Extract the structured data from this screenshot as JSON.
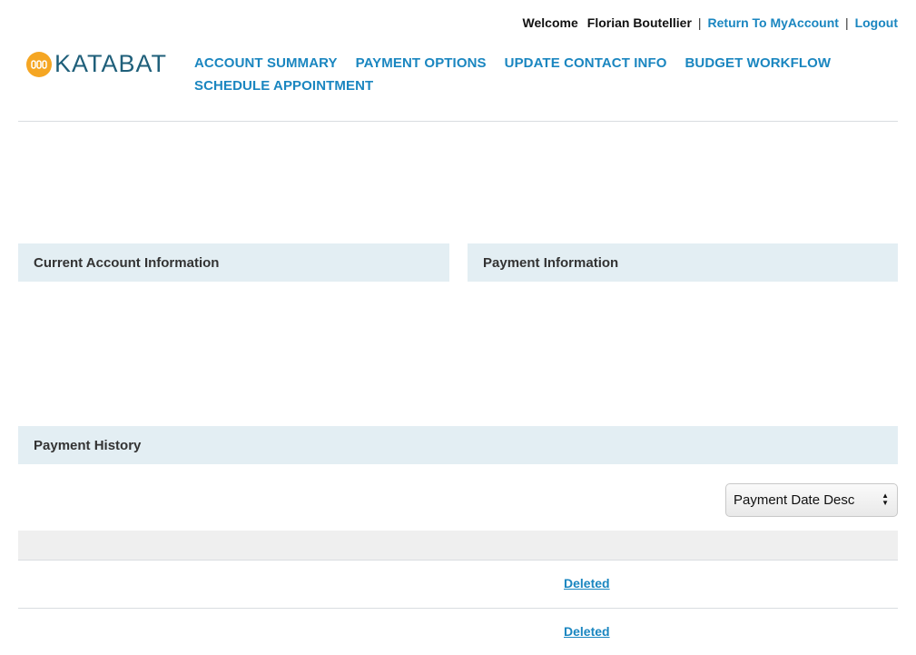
{
  "header": {
    "welcome": "Welcome",
    "user_name": "Florian Boutellier",
    "separator": "|",
    "return_link": "Return To MyAccount",
    "logout_link": "Logout"
  },
  "logo": {
    "text": "KATABAT",
    "icon": "katabat-logo-icon",
    "icon_color": "#f5a623"
  },
  "nav": {
    "items": [
      {
        "label": "ACCOUNT SUMMARY"
      },
      {
        "label": "PAYMENT OPTIONS"
      },
      {
        "label": "UPDATE CONTACT INFO"
      },
      {
        "label": "BUDGET WORKFLOW"
      },
      {
        "label": "SCHEDULE APPOINTMENT"
      }
    ]
  },
  "sections": {
    "current_account": "Current Account Information",
    "payment_info": "Payment Information",
    "payment_history": "Payment History"
  },
  "sort": {
    "selected": "Payment Date Desc"
  },
  "history_rows": [
    {
      "status": "Deleted"
    },
    {
      "status": "Deleted"
    }
  ],
  "colors": {
    "link": "#1a86c0",
    "panel_header_bg": "#e3eef3",
    "brand_text": "#1f5f7a"
  }
}
